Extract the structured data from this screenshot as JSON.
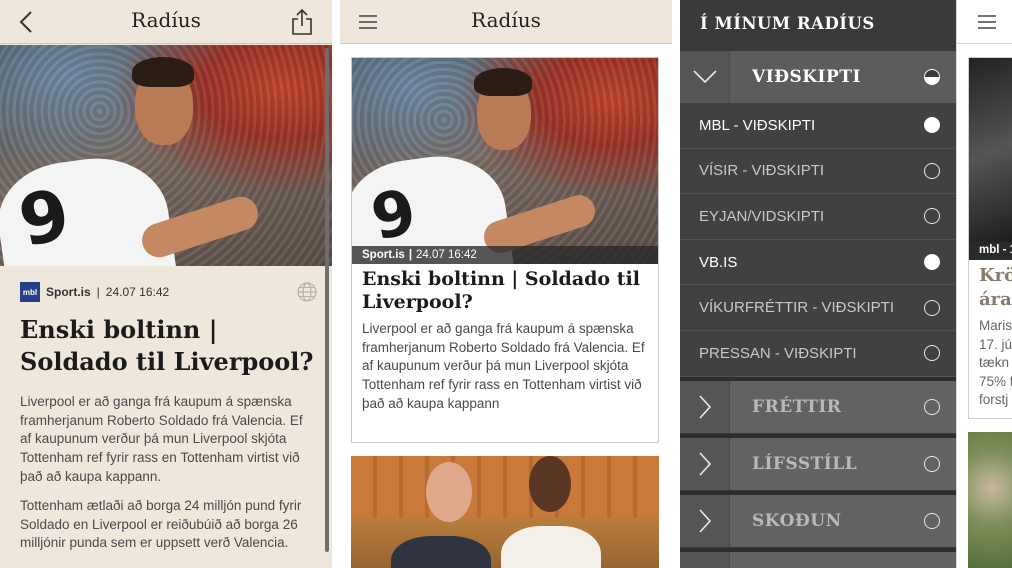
{
  "screen1": {
    "nav": {
      "title": "Radíus",
      "back_icon": "chevron-left-icon",
      "share_icon": "share-icon"
    },
    "article": {
      "source_logo": "mbl",
      "source": "Sport.is",
      "separator": "|",
      "timestamp": "24.07 16:42",
      "globe_icon": "globe-icon",
      "headline": "Enski boltinn | Soldado til Liverpool?",
      "paragraphs": [
        "Liverpool er að ganga frá kaupum á spænska framherjanum Roberto Soldado frá Valencia. Ef af kaupunum verður þá mun Liverpool skjóta Tottenham ref fyrir rass en Tottenham virtist við það að kaupa kappann.",
        "Tottenham ætlaði að borga 24 milljón pund fyrir Soldado en Liverpool er reiðubúið að borga 26 milljónir punda sem er uppsett verð Valencia."
      ]
    }
  },
  "screen2": {
    "nav": {
      "title": "Radíus",
      "menu_icon": "hamburger-menu-icon"
    },
    "card": {
      "source": "Sport.is",
      "separator": "|",
      "timestamp": "24.07 16:42",
      "headline": "Enski boltinn | Soldado til Liverpool?",
      "summary": "Liverpool er að ganga frá kaupum á spænska framherjanum Roberto Soldado frá Valencia. Ef af kaupunum verður þá mun Liverpool skjóta Tottenham ref fyrir rass en Tottenham virtist við það að kaupa kappann"
    }
  },
  "screen3": {
    "header": "Í MÍNUM RADÍUS",
    "open_group": {
      "label": "VIÐSKIPTI",
      "state": "partial"
    },
    "sources": [
      {
        "label": "MBL - VIÐSKIPTI",
        "selected": true
      },
      {
        "label": "VÍSIR - VIÐSKIPTI",
        "selected": false
      },
      {
        "label": "EYJAN/VIDSKIPTI",
        "selected": false
      },
      {
        "label": "VB.IS",
        "selected": true
      },
      {
        "label": "VÍKURFRÉTTIR - VIÐSKIPTI",
        "selected": false
      },
      {
        "label": "PRESSAN - VIÐSKIPTI",
        "selected": false
      }
    ],
    "groups": [
      {
        "label": "FRÉTTIR",
        "selected": false
      },
      {
        "label": "LÍFSSTÍLL",
        "selected": false
      },
      {
        "label": "SKOÐUN",
        "selected": false
      }
    ]
  },
  "screen4": {
    "menu_icon": "hamburger-menu-icon",
    "caption": "mbl - 1",
    "title_fragment": "Krö ára",
    "text_fragment": "Maris 17. jú tækn 75% f forstj"
  },
  "colors": {
    "article_bg": "#efe7dc",
    "menu_bg": "#3a3a3a",
    "menu_row_bg": "#414141",
    "menu_group_bg": "#626262"
  }
}
